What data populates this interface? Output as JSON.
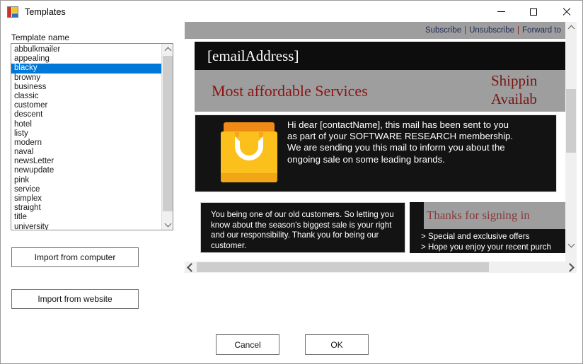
{
  "window": {
    "title": "Templates",
    "icon": "form-icon",
    "minimize_label": "Minimize",
    "maximize_label": "Maximize",
    "close_label": "Close"
  },
  "left_panel": {
    "list_label": "Template name",
    "selected": "blacky",
    "templates": [
      "abbulkmailer",
      "appealing",
      "blacky",
      "browny",
      "business",
      "classic",
      "customer",
      "descent",
      "hotel",
      "listy",
      "modern",
      "naval",
      "newsLetter",
      "newupdate",
      "pink",
      "service",
      "simplex",
      "straight",
      "title",
      "university"
    ],
    "import_computer_label": "Import from computer",
    "import_website_label": "Import from website"
  },
  "dialog_buttons": {
    "cancel_label": "Cancel",
    "ok_label": "OK"
  },
  "preview": {
    "toplinks": {
      "subscribe": "Subscribe",
      "separator": "|",
      "unsubscribe": "Unsubscribe",
      "forward": "Forward to"
    },
    "email_address": "[emailAddress]",
    "hero_title": "Most affordable Services",
    "hero_shipping_line1": "Shippin",
    "hero_shipping_line2": "Availab",
    "body_icon": "shopping-bag-icon",
    "body_text": "Hi dear [contactName], this mail has been sent to you as part of your SOFTWARE RESEARCH membership. We are sending you this mail to inform you about the ongoing sale on some leading brands.",
    "footer_left_text": "You being one of our old customers. So letting you know about the season's biggest sale is your right and our responsibility. Thank you for being our customer.",
    "footer_right_heading": "Thanks for signing in",
    "footer_right_bullets": "> Special and exclusive offers\n> Hope you enjoy your recent purch"
  },
  "colors": {
    "accent": "#0078d7",
    "email_dark": "#131313",
    "hero_gray": "#9e9e9e",
    "hero_red": "#8b1414",
    "bag_yellow": "#fbc01b",
    "bag_orange": "#ef8a17"
  }
}
